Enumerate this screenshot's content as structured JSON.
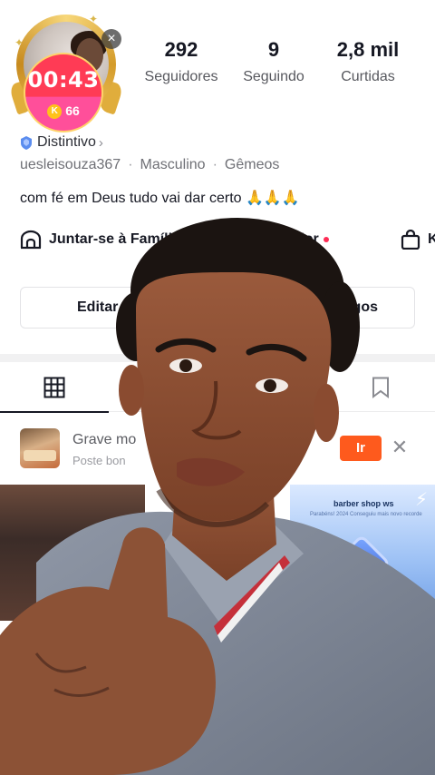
{
  "profile": {
    "live_timer": "00:43",
    "coin_count": "66",
    "close_symbol": "×",
    "stats": [
      {
        "value": "292",
        "label": "Seguidores"
      },
      {
        "value": "9",
        "label": "Seguindo"
      },
      {
        "value": "2,8 mil",
        "label": "Curtidas"
      }
    ],
    "badge_label": "Distintivo",
    "badge_chevron": "›",
    "username": "uesleisouza367",
    "gender": "Masculino",
    "sign": "Gêmeos",
    "separator": "·",
    "bio_text": "com fé em Deus tudo vai dar certo ",
    "bio_emoji": "🙏🙏🙏",
    "links": [
      {
        "label": "Juntar-se à Família",
        "icon": "family-house-icon"
      },
      {
        "label": "l do Criador",
        "icon": "creator-portal-icon"
      },
      {
        "label": "K",
        "icon": "shopping-bag-icon"
      }
    ],
    "edit_button": "Editar pe",
    "friends_button": "igos"
  },
  "tabs": [
    {
      "icon": "grid-icon",
      "active": true
    },
    {
      "icon": "lock-icon",
      "active": false
    },
    {
      "icon": "heart-icon",
      "active": false
    },
    {
      "icon": "bookmark-icon",
      "active": false
    }
  ],
  "promo": {
    "title": "Grave mo",
    "subtitle": "Poste bon",
    "go_label": "Ir",
    "close_symbol": "✕"
  },
  "grid": {
    "right_card_title": "barber shop ws",
    "right_card_sub": "Parabéns! 2024 Conseguiu mais novo recorde"
  },
  "colors": {
    "accent_red": "#fe2c55",
    "promo_orange": "#fe5a1d",
    "timer_red": "#ff3b55",
    "timer_pink": "#ff4f9a",
    "gold": "#ffd36a"
  }
}
